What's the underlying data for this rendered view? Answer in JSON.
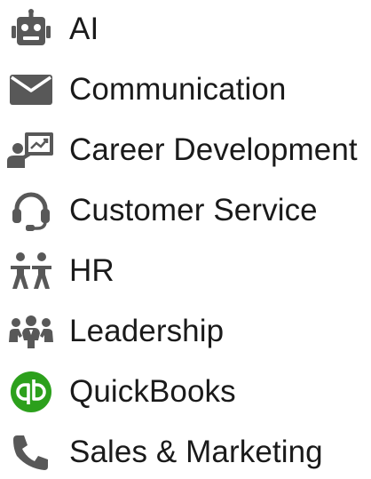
{
  "colors": {
    "text": "#1a1a1a",
    "icon": "#585858",
    "quickbooks_green": "#2ca01c"
  },
  "menu": {
    "items": [
      {
        "id": "ai",
        "label": "AI",
        "icon": "robot-icon"
      },
      {
        "id": "communication",
        "label": "Communication",
        "icon": "envelope-icon"
      },
      {
        "id": "career-development",
        "label": "Career Development",
        "icon": "presentation-icon"
      },
      {
        "id": "customer-service",
        "label": "Customer Service",
        "icon": "headset-icon"
      },
      {
        "id": "hr",
        "label": "HR",
        "icon": "people-icon"
      },
      {
        "id": "leadership",
        "label": "Leadership",
        "icon": "group-icon"
      },
      {
        "id": "quickbooks",
        "label": "QuickBooks",
        "icon": "quickbooks-logo-icon"
      },
      {
        "id": "sales-marketing",
        "label": "Sales & Marketing",
        "icon": "phone-icon"
      }
    ]
  }
}
